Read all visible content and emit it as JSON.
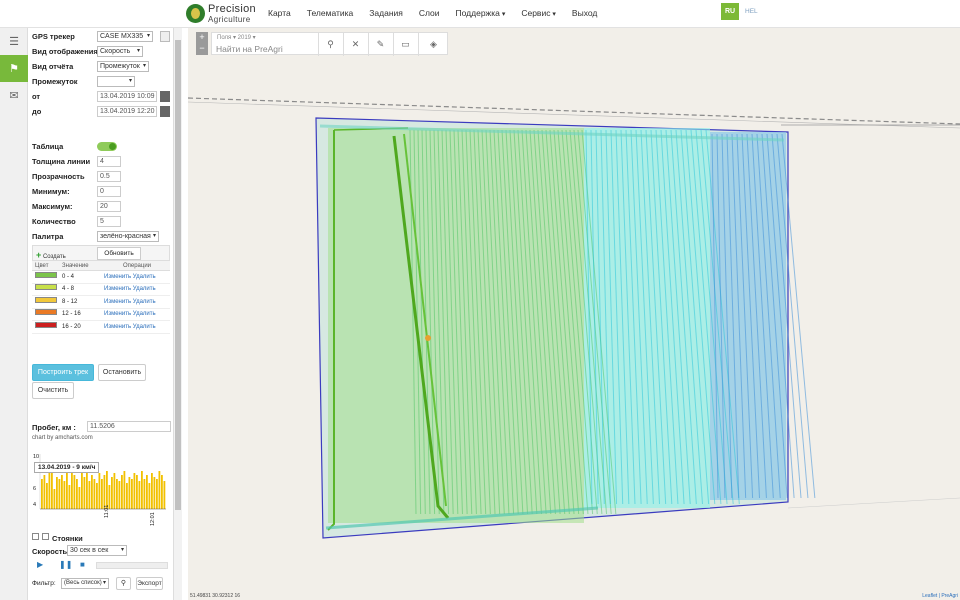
{
  "brand": {
    "name_line1": "Precision",
    "name_line2": "Agriculture"
  },
  "nav": [
    {
      "label": "Карта"
    },
    {
      "label": "Телематика"
    },
    {
      "label": "Задания"
    },
    {
      "label": "Слои"
    },
    {
      "label": "Поддержка",
      "dropdown": true
    },
    {
      "label": "Сервис",
      "dropdown": true
    },
    {
      "label": "Выход"
    }
  ],
  "lang": "RU",
  "user_link": "HEL",
  "panel": {
    "gps_label": "GPS трекер",
    "gps_value": "CASE MX335",
    "view_label": "Вид отображения",
    "view_value": "Скорость",
    "report_label": "Вид отчёта",
    "report_value": "Промежуток",
    "interval_label": "Промежуток",
    "interval_value": "",
    "from_label": "от",
    "from_value": "13.04.2019 10:09",
    "to_label": "до",
    "to_value": "13.04.2019 12:20",
    "table_label": "Таблица",
    "line_label": "Толщина линии",
    "line_value": "4",
    "opacity_label": "Прозрачность",
    "opacity_value": "0.5",
    "min_label": "Минимум:",
    "min_value": "0",
    "max_label": "Максимум:",
    "max_value": "20",
    "count_label": "Количество",
    "count_value": "5",
    "palette_label": "Палитра",
    "palette_value": "зелёно-красная"
  },
  "palette_table": {
    "add_label": "Создать",
    "update_label": "Обновить",
    "headers": [
      "Цвет",
      "Значение",
      "Операции"
    ],
    "edit_label": "Изменить",
    "delete_label": "Удалить",
    "rows": [
      {
        "color": "#7cc44a",
        "range": "0 - 4"
      },
      {
        "color": "#c8e04a",
        "range": "4 - 8"
      },
      {
        "color": "#f2c83a",
        "range": "8 - 12"
      },
      {
        "color": "#ea7a25",
        "range": "12 - 16"
      },
      {
        "color": "#cc1f1f",
        "range": "16 - 20"
      }
    ]
  },
  "buttons": {
    "build": "Построить трек",
    "stop": "Остановить",
    "clear": "Очистить"
  },
  "mileage": {
    "label": "Пробег, км :",
    "value": "11.5206"
  },
  "chart": {
    "credit": "chart by amcharts.com",
    "tooltip": "13.04.2019 - 9 км/ч",
    "y_ticks": [
      "10",
      "6",
      "4"
    ],
    "x_ticks": [
      "11:01",
      "12:01"
    ]
  },
  "stops_label": "Стоянки",
  "speed": {
    "label": "Скорость",
    "value": "30 сек в сек"
  },
  "filter": {
    "label": "Фильтр:",
    "value": "(Весь список)",
    "export": "Экспорт"
  },
  "map": {
    "search_meta_1": "Поля",
    "search_meta_2": "2019",
    "search_placeholder": "Найти на PreAgri",
    "coords": "51.49831 30.92312 16",
    "attribution": "Leaflet | PreAgri"
  }
}
